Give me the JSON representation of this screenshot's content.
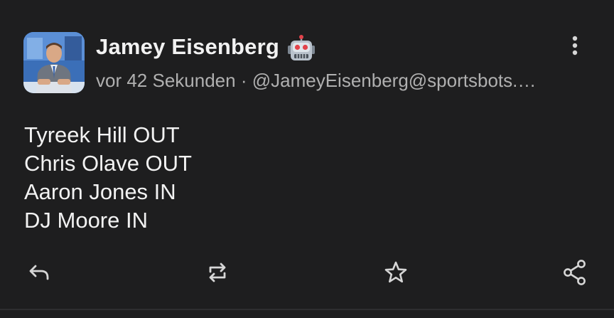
{
  "post": {
    "author_name": "Jamey Eisenberg",
    "bot_badge": "robot-emoji",
    "timestamp": "vor 42 Sekunden",
    "separator": "·",
    "handle": "@JameyEisenberg@sportsbots.…",
    "lines": [
      "Tyreek Hill OUT",
      "Chris Olave OUT",
      "Aaron Jones IN",
      "DJ Moore IN"
    ]
  },
  "actions": {
    "reply_icon": "reply-icon",
    "boost_icon": "boost-icon",
    "favourite_icon": "star-icon",
    "share_icon": "share-icon",
    "more_icon": "more-vertical-icon"
  },
  "colors": {
    "background": "#1e1e1f",
    "text_primary": "#f2f2f2",
    "text_secondary": "#b0b0b0",
    "icon": "#d6d6d6"
  }
}
